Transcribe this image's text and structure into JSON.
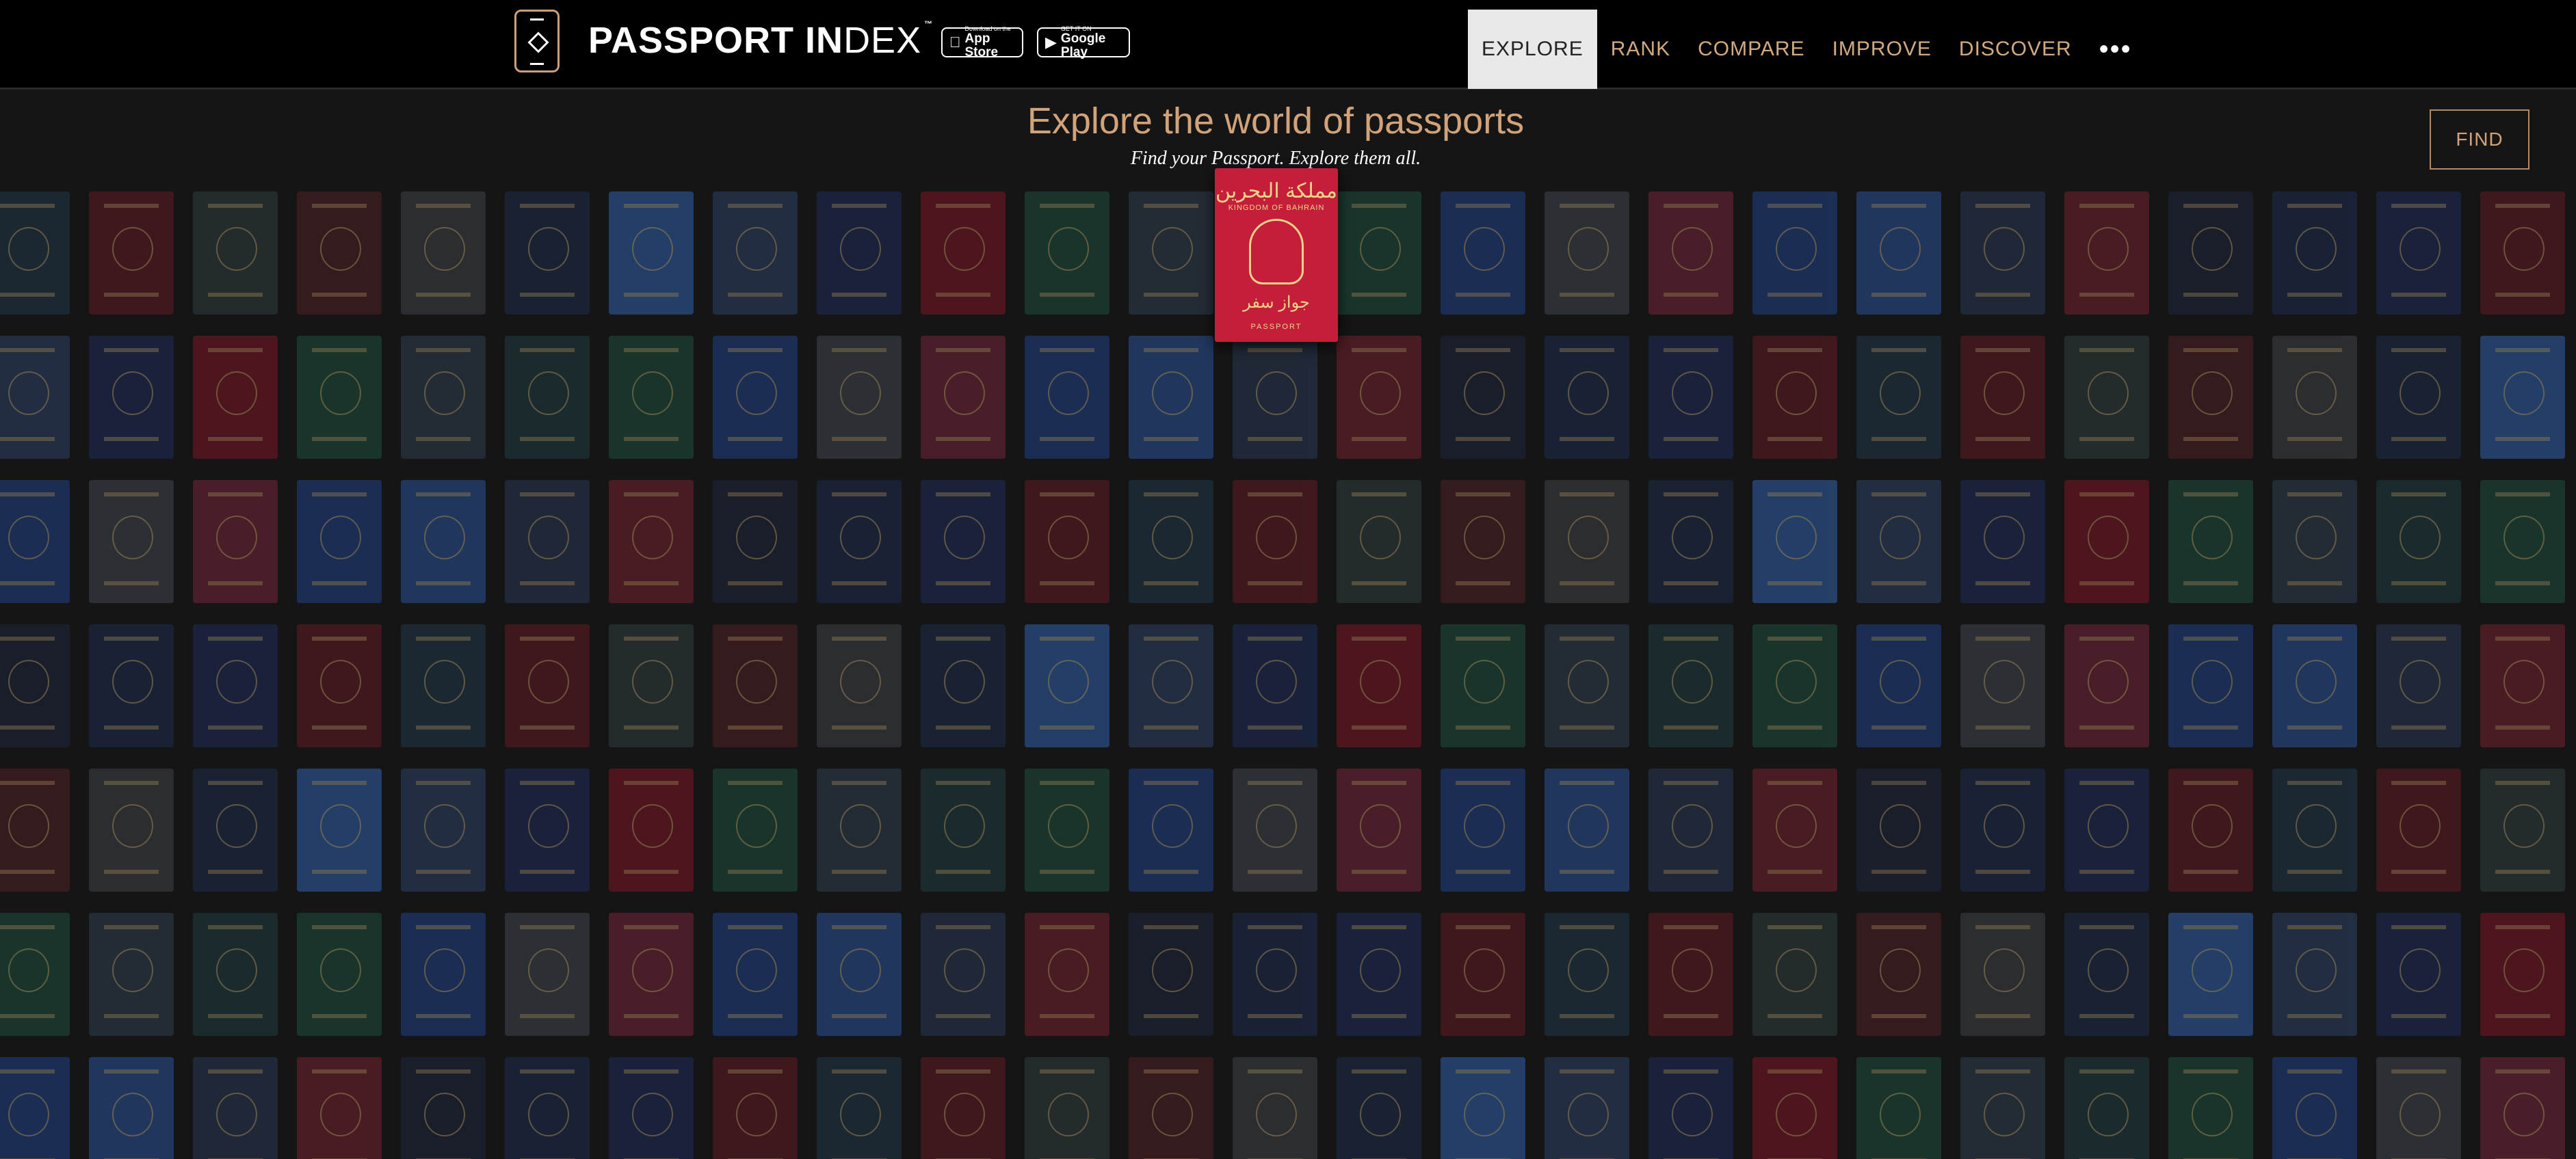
{
  "brand": {
    "name_bold": "PASSPORT IN",
    "name_light": "DEX",
    "tm": "™"
  },
  "stores": [
    {
      "line1": "Download on the",
      "line2": "App Store",
      "icon": "apple-icon"
    },
    {
      "line1": "GET IT ON",
      "line2": "Google Play",
      "icon": "google-play-icon"
    }
  ],
  "nav": {
    "items": [
      {
        "label": "EXPLORE",
        "active": true
      },
      {
        "label": "RANK",
        "active": false
      },
      {
        "label": "COMPARE",
        "active": false
      },
      {
        "label": "IMPROVE",
        "active": false
      },
      {
        "label": "DISCOVER",
        "active": false
      }
    ],
    "more": "•••"
  },
  "hero": {
    "title": "Explore the world of passports",
    "subtitle": "Find your Passport. Explore them all."
  },
  "find_button": "FIND",
  "featured_passport": {
    "arabic_title": "مملكة البحرين",
    "country": "KINGDOM OF BAHRAIN",
    "arabic_word": "جواز سفر",
    "label": "PASSPORT",
    "color": "#c41e3a"
  },
  "passport_colors": [
    "#203445",
    "#5a1a24",
    "#2c3a3c",
    "#4a1e24",
    "#3a3d42",
    "#1d2a45",
    "#2d5a9a",
    "#2a3d5e",
    "#1c2a52",
    "#701522",
    "#1d4a3a",
    "#2c3a4a",
    "#1f3a3c",
    "#1d4a3a",
    "#1f3c7a",
    "#3b3f48",
    "#6a2535",
    "#1f3d7a",
    "#284b8a",
    "#27354d",
    "#6a1f2a",
    "#1d2438",
    "#1c2a4a",
    "#1c2a52",
    "#5a1a24"
  ],
  "colors": {
    "accent": "#d2a278",
    "background": "#151515",
    "topbar": "#000000"
  }
}
